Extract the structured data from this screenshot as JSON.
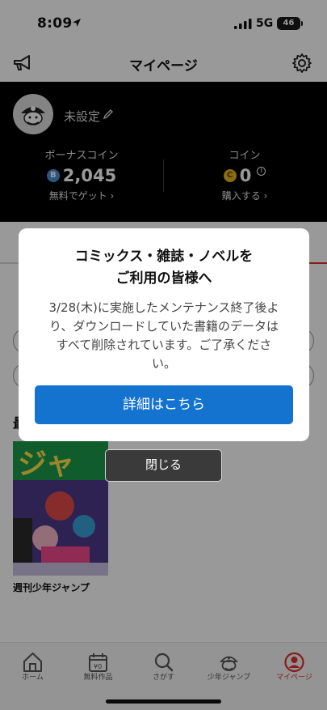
{
  "status_bar": {
    "time": "8:09",
    "network": "5G",
    "battery": "46"
  },
  "nav": {
    "title": "マイページ",
    "left_icon": "megaphone-icon",
    "right_icon": "gear-icon"
  },
  "profile": {
    "username": "未設定",
    "bonus_coin": {
      "label": "ボーナスコイン",
      "badge": "B",
      "value": "2,045",
      "link": "無料でゲット ›",
      "color": "#4a8fd8"
    },
    "coin": {
      "label": "コイン",
      "badge": "C",
      "value": "0",
      "info": "i",
      "link": "購入する ›",
      "color": "#e6b422"
    }
  },
  "content": {
    "book_title": "週刊少年ジャンプ"
  },
  "tab_bar": {
    "items": [
      {
        "label": "ホーム",
        "icon": "home-icon"
      },
      {
        "label": "無料作品",
        "icon": "calendar-icon"
      },
      {
        "label": "さがす",
        "icon": "search-icon"
      },
      {
        "label": "少年ジャンプ",
        "icon": "jump-pirate-icon"
      },
      {
        "label": "マイページ",
        "icon": "person-icon",
        "active": true
      }
    ],
    "active_color": "#e03030"
  },
  "modal": {
    "title_line1": "コミックス・雑誌・ノベルを",
    "title_line2": "ご利用の皆様へ",
    "body_line1": "3/28(木)に実施したメンテナンス終了後よ",
    "body_line2": "り、ダウンロードしていた書籍のデータは",
    "body_line3": "すべて削除されています。ご了承くださ",
    "body_line4": "い。",
    "detail_button": "詳細はこちら",
    "close_button": "閉じる"
  }
}
